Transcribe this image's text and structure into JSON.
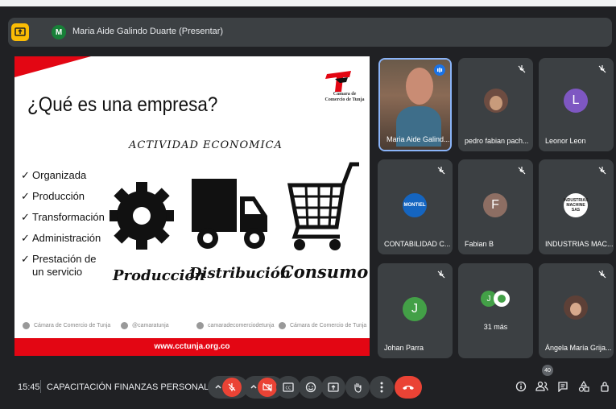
{
  "presenting_bar": {
    "presenter_initial": "M",
    "presenter_label": "Maria Aide Galindo Duarte (Presentar)"
  },
  "slide": {
    "title": "¿Qué es una empresa?",
    "subtitle": "ACTIVIDAD ECONOMICA",
    "logo_text": "Cámara de Comercio de Tunja",
    "list": [
      "Organizada",
      "Producción",
      "Transformación",
      "Administración",
      "Prestación de",
      "un servicio"
    ],
    "captions": [
      "Producción",
      "Distribución",
      "Consumo"
    ],
    "social": [
      "Cámara de Comercio de Tunja",
      "@camaratunja",
      "camaradecomerciodetunja",
      "Cámara de Comercio de Tunja"
    ],
    "footer_url": "www.cctunja.org.co",
    "accent_color": "#e30613"
  },
  "participants": [
    {
      "name": "Maria Aide Galind...",
      "kind": "video"
    },
    {
      "name": "pedro fabian pach...",
      "kind": "photo"
    },
    {
      "name": "Leonor Leon",
      "kind": "initial",
      "initial": "L",
      "color": "#7e57c2"
    },
    {
      "name": "CONTABILIDAD C...",
      "kind": "logo",
      "logo_text": "MONTIEL"
    },
    {
      "name": "Fabian B",
      "kind": "initial",
      "initial": "F",
      "color": "#8d6e63"
    },
    {
      "name": "INDUSTRIAS MAC...",
      "kind": "logo",
      "logo_text": "INDUSTRIAS MACHINE SAS"
    },
    {
      "name": "Johan Parra",
      "kind": "initial",
      "initial": "J",
      "color": "#43a047"
    },
    {
      "name": "31 más",
      "kind": "more",
      "initial": "J"
    },
    {
      "name": "Ángela María Grija...",
      "kind": "photo"
    }
  ],
  "bottom_bar": {
    "time": "15:45",
    "meeting_title": "CAPACITACIÓN FINANZAS PERSONALES Y ...",
    "participant_count": "40",
    "icons": [
      "mic-off-icon",
      "camera-off-icon",
      "captions-icon",
      "emoji-icon",
      "present-icon",
      "raise-hand-icon",
      "more-options-icon",
      "end-call-icon",
      "info-icon",
      "people-icon",
      "chat-icon",
      "activities-icon",
      "host-controls-icon"
    ]
  }
}
